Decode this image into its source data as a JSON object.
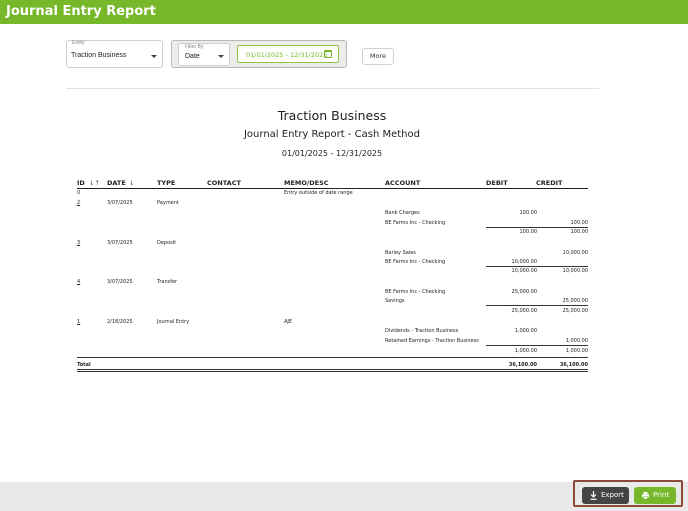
{
  "app": {
    "title": "Journal Entry Report"
  },
  "filters": {
    "entity_label": "Entity",
    "entity_value": "Traction Business",
    "filterby_label": "Filter By",
    "filterby_value": "Date",
    "date_range": "01/01/2025 - 12/31/2025",
    "more_label": "More"
  },
  "report": {
    "company": "Traction Business",
    "title": "Journal Entry Report - Cash Method",
    "range": "01/01/2025 - 12/31/2025",
    "columns": {
      "id": "ID",
      "date": "DATE",
      "type": "TYPE",
      "contact": "CONTACT",
      "memo": "MEMO/DESC",
      "account": "ACCOUNT",
      "debit": "DEBIT",
      "credit": "CREDIT"
    },
    "rows": {
      "r0_id": "0",
      "r0_memo": "Entry outside of date range",
      "e2_id": "2",
      "e2_date": "3/07/2025",
      "e2_type": "Payment",
      "e2_l1_acct": "Bank Charges",
      "e2_l1_debit": "100.00",
      "e2_l2_acct": "BE Farms Inc - Checking",
      "e2_l2_credit": "100.00",
      "e2_tot_debit": "100.00",
      "e2_tot_credit": "100.00",
      "e3_id": "3",
      "e3_date": "3/07/2025",
      "e3_type": "Deposit",
      "e3_l1_acct": "Barley Sales",
      "e3_l1_credit": "10,000.00",
      "e3_l2_acct": "BE Farms Inc - Checking",
      "e3_l2_debit": "10,000.00",
      "e3_tot_debit": "10,000.00",
      "e3_tot_credit": "10,000.00",
      "e4_id": "4",
      "e4_date": "3/07/2025",
      "e4_type": "Transfer",
      "e4_l1_acct": "BE Farms Inc - Checking",
      "e4_l1_debit": "25,000.00",
      "e4_l2_acct": "Savings",
      "e4_l2_credit": "25,000.00",
      "e4_tot_debit": "25,000.00",
      "e4_tot_credit": "25,000.00",
      "e1_id": "1",
      "e1_date": "2/18/2025",
      "e1_type": "Journal Entry",
      "e1_memo": "AJE",
      "e1_l1_acct": "Dividends - Traction Business",
      "e1_l1_debit": "1,000.00",
      "e1_l2_acct": "Retained Earnings - Traction Business",
      "e1_l2_credit": "1,000.00",
      "e1_tot_debit": "1,000.00",
      "e1_tot_credit": "1,000.00",
      "total_label": "Total",
      "total_debit": "36,100.00",
      "total_credit": "36,100.00"
    }
  },
  "footer": {
    "export_label": "Export",
    "print_label": "Print"
  },
  "colors": {
    "brand_green": "#76b82a",
    "export_dark": "#444444"
  }
}
